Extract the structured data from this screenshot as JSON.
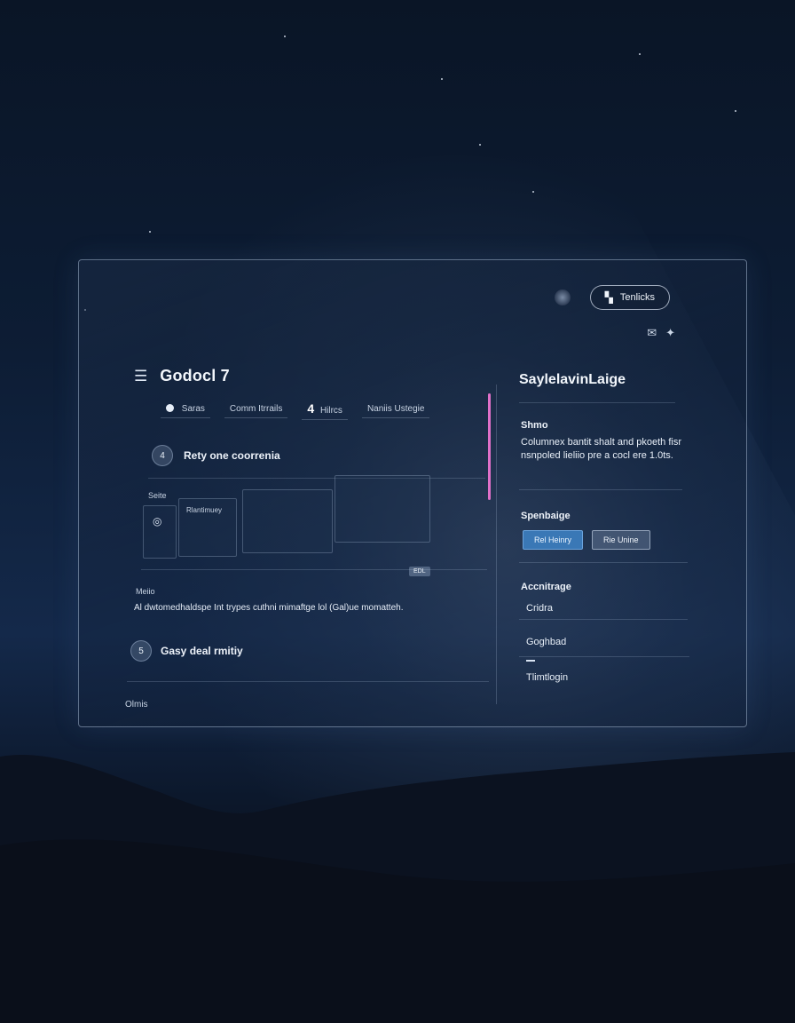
{
  "colors": {
    "accent_pink": "#e070c8",
    "primary_button": "#3a78b6",
    "panel_border": "#bed2eb",
    "sky_top": "#0a1526"
  },
  "top_actions": {
    "pill_icon": "grid-icon",
    "pill_label": "Tenlicks",
    "mini_icons": [
      "mail-icon",
      "sparkle-icon"
    ]
  },
  "header": {
    "menu_icon": "menu-icon",
    "title": "Godocl 7"
  },
  "tabs": [
    {
      "label": "Saras"
    },
    {
      "label": "Comm Itrrails"
    },
    {
      "num": "4",
      "label": "Hilrcs"
    },
    {
      "label": "Naniis Ustegie"
    }
  ],
  "main": {
    "row_a": {
      "num": "4",
      "label": "Rety one coorrenia"
    },
    "section_label": "Seite",
    "tile_caption": "Rlantimuey",
    "tag": "EDL",
    "desc_label": "Meiio",
    "desc_text": "Al dwtomedhaldspe Int trypes cuthni mimaftge lol (Gal)ue momatteh.",
    "row_b": {
      "num": "5",
      "label": "Gasy deal rmitiy"
    },
    "footer_label": "Olmis"
  },
  "side": {
    "title": "SaylelavinLaige",
    "section1_heading": "Shmo",
    "section1_body": "Columnex bantit shalt and pkoeth fisr nsnpoled lieliio pre a cocl ere 1.0ts.",
    "section2_heading": "Spenbaige",
    "buttons": [
      "Rel Heinry",
      "Rie Unine"
    ],
    "section3_heading": "Accnitrage",
    "items": [
      "Cridra",
      "Goghbad",
      "Tlimtlogin"
    ]
  }
}
